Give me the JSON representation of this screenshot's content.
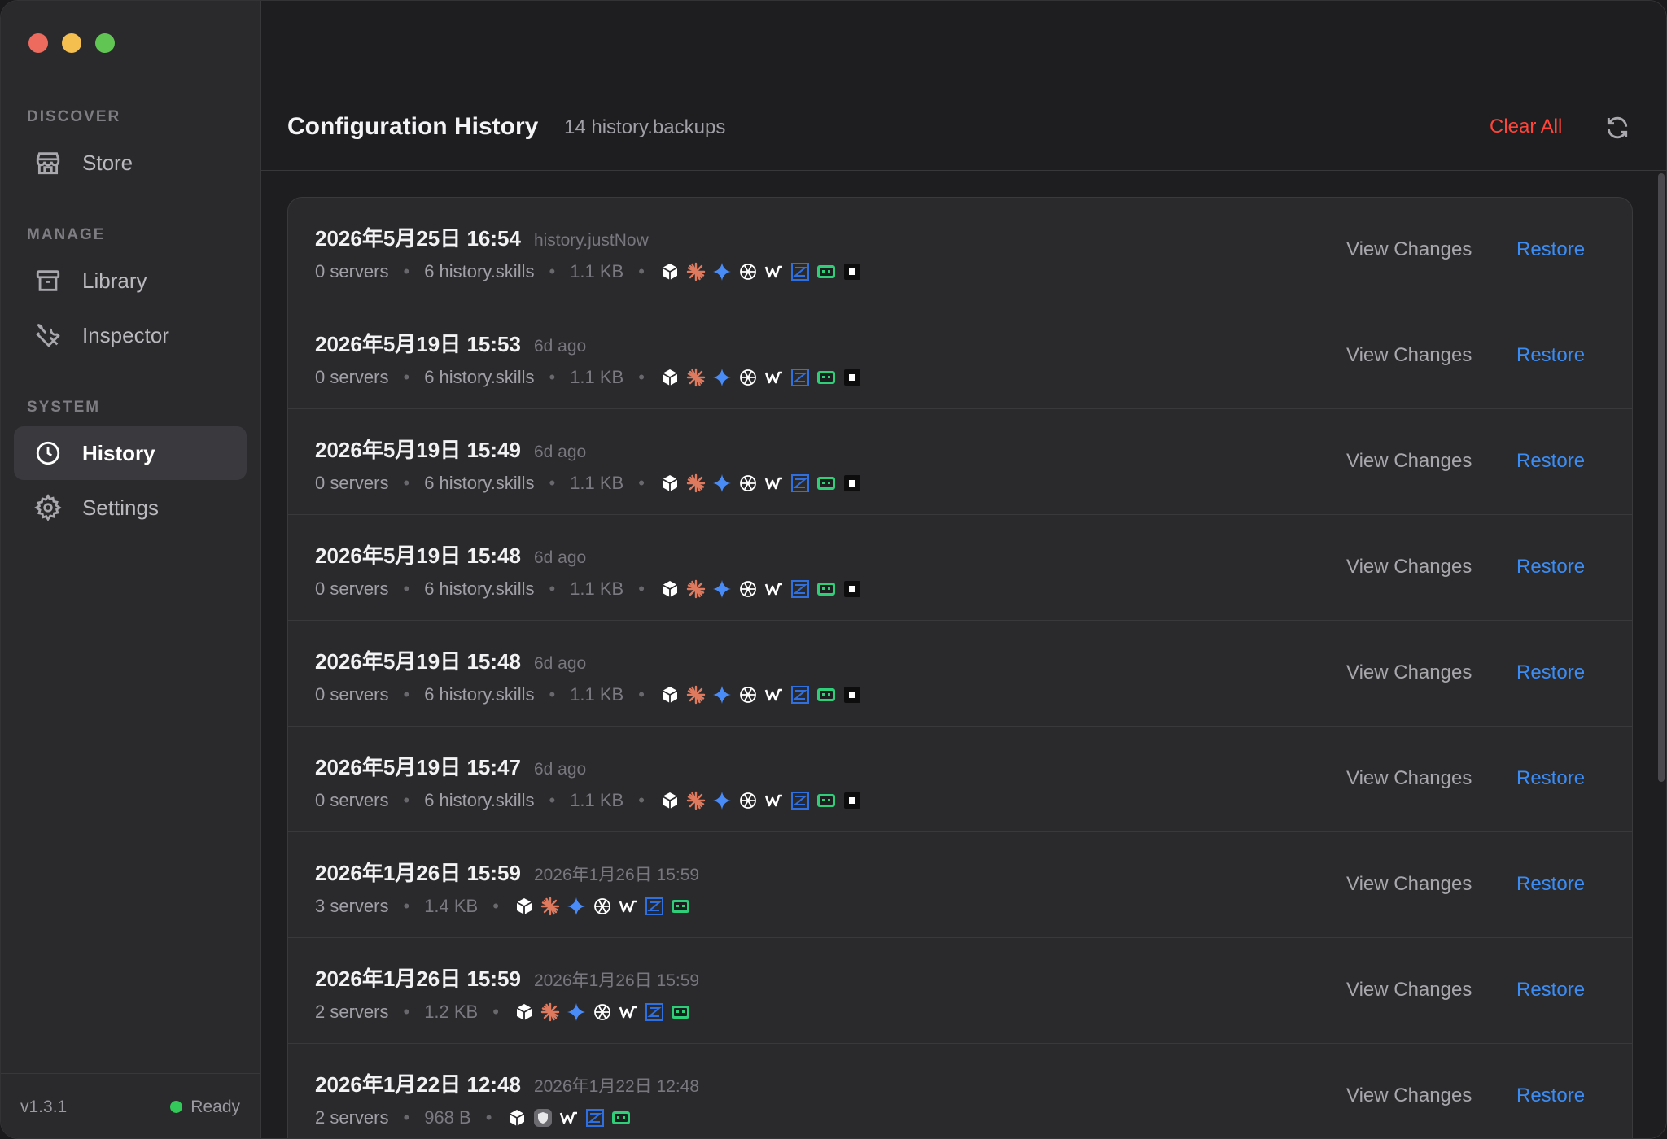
{
  "window": {
    "traffic_lights": [
      "close",
      "minimize",
      "zoom"
    ]
  },
  "sidebar": {
    "sections": [
      {
        "label": "DISCOVER",
        "items": [
          {
            "label": "Store",
            "icon": "store-icon"
          }
        ]
      },
      {
        "label": "MANAGE",
        "items": [
          {
            "label": "Library",
            "icon": "archive-icon"
          },
          {
            "label": "Inspector",
            "icon": "tools-icon"
          }
        ]
      },
      {
        "label": "SYSTEM",
        "items": [
          {
            "label": "History",
            "icon": "clock-icon",
            "active": true
          },
          {
            "label": "Settings",
            "icon": "gear-icon"
          }
        ]
      }
    ],
    "footer": {
      "version": "v1.3.1",
      "status": "Ready",
      "status_color": "#34c759"
    }
  },
  "header": {
    "title": "Configuration History",
    "count": "14 history.backups",
    "clear_all": "Clear All",
    "refresh_icon": "refresh-icon"
  },
  "actions": {
    "view_changes": "View Changes",
    "restore": "Restore"
  },
  "rows": [
    {
      "date": "2026年5月25日 16:54",
      "ago": "history.justNow",
      "servers": "0 servers",
      "skills": "6 history.skills",
      "size": "1.1 KB",
      "icons": [
        "cube",
        "claude",
        "gemini",
        "openai",
        "windsurf",
        "zed",
        "copilot",
        "terminal"
      ]
    },
    {
      "date": "2026年5月19日 15:53",
      "ago": "6d ago",
      "servers": "0 servers",
      "skills": "6 history.skills",
      "size": "1.1 KB",
      "icons": [
        "cube",
        "claude",
        "gemini",
        "openai",
        "windsurf",
        "zed",
        "copilot",
        "terminal"
      ]
    },
    {
      "date": "2026年5月19日 15:49",
      "ago": "6d ago",
      "servers": "0 servers",
      "skills": "6 history.skills",
      "size": "1.1 KB",
      "icons": [
        "cube",
        "claude",
        "gemini",
        "openai",
        "windsurf",
        "zed",
        "copilot",
        "terminal"
      ]
    },
    {
      "date": "2026年5月19日 15:48",
      "ago": "6d ago",
      "servers": "0 servers",
      "skills": "6 history.skills",
      "size": "1.1 KB",
      "icons": [
        "cube",
        "claude",
        "gemini",
        "openai",
        "windsurf",
        "zed",
        "copilot",
        "terminal"
      ]
    },
    {
      "date": "2026年5月19日 15:48",
      "ago": "6d ago",
      "servers": "0 servers",
      "skills": "6 history.skills",
      "size": "1.1 KB",
      "icons": [
        "cube",
        "claude",
        "gemini",
        "openai",
        "windsurf",
        "zed",
        "copilot",
        "terminal"
      ]
    },
    {
      "date": "2026年5月19日 15:47",
      "ago": "6d ago",
      "servers": "0 servers",
      "skills": "6 history.skills",
      "size": "1.1 KB",
      "icons": [
        "cube",
        "claude",
        "gemini",
        "openai",
        "windsurf",
        "zed",
        "copilot",
        "terminal"
      ]
    },
    {
      "date": "2026年1月26日 15:59",
      "ago": "2026年1月26日 15:59",
      "servers": "3 servers",
      "skills": "",
      "size": "1.4 KB",
      "icons": [
        "cube",
        "claude",
        "gemini",
        "openai",
        "windsurf",
        "zed",
        "copilot"
      ]
    },
    {
      "date": "2026年1月26日 15:59",
      "ago": "2026年1月26日 15:59",
      "servers": "2 servers",
      "skills": "",
      "size": "1.2 KB",
      "icons": [
        "cube",
        "claude",
        "gemini",
        "openai",
        "windsurf",
        "zed",
        "copilot"
      ]
    },
    {
      "date": "2026年1月22日 12:48",
      "ago": "2026年1月22日 12:48",
      "servers": "2 servers",
      "skills": "",
      "size": "968 B",
      "icons": [
        "cube",
        "shield",
        "windsurf",
        "zed",
        "copilot"
      ]
    }
  ]
}
